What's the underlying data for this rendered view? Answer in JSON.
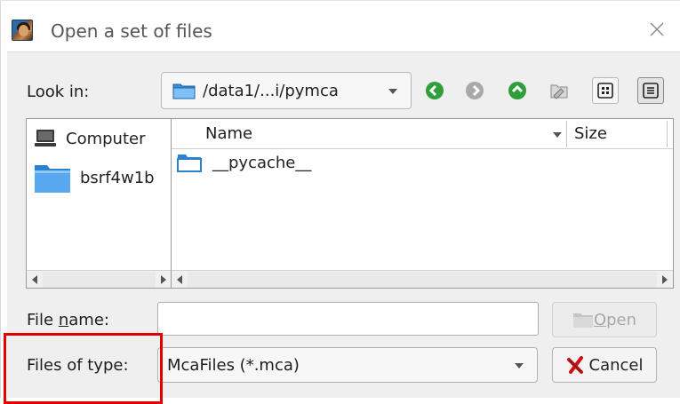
{
  "window": {
    "title": "Open a set of files",
    "close_icon": "close-icon"
  },
  "lookin": {
    "label": "Look in:",
    "path": "/data1/...i/pymca"
  },
  "toolbar": {
    "buttons": [
      "back-icon",
      "forward-icon",
      "parent-directory-icon",
      "new-folder-icon",
      "list-view-icon",
      "detail-view-icon"
    ]
  },
  "sidebar": {
    "items": [
      {
        "label": "Computer",
        "icon": "computer-icon"
      },
      {
        "label": "bsrf4w1b",
        "icon": "folder-icon"
      }
    ]
  },
  "filelist": {
    "columns": [
      "Name",
      "Size"
    ],
    "rows": [
      {
        "name": "__pycache__",
        "icon": "folder-icon"
      }
    ]
  },
  "filename": {
    "label_prefix": "File ",
    "label_accel": "n",
    "label_suffix": "ame:",
    "value": ""
  },
  "open_button": {
    "accel": "O",
    "rest": "pen"
  },
  "filetype": {
    "label": "Files of type:",
    "value": "McaFiles (*.mca)"
  },
  "cancel_button": {
    "label": "Cancel"
  },
  "colors": {
    "highlight": "#e00000",
    "nav_green": "#2f9e3b",
    "folder_blue": "#3a8fd8"
  }
}
